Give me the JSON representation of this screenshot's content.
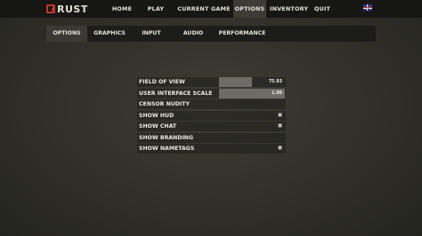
{
  "brand": {
    "name": "RUST",
    "logo_icon": "rust-logo-icon"
  },
  "nav": {
    "items": [
      {
        "label": "HOME",
        "active": false
      },
      {
        "label": "PLAY",
        "active": false
      },
      {
        "label": "CURRENT GAME",
        "active": false
      },
      {
        "label": "OPTIONS",
        "active": true
      },
      {
        "label": "INVENTORY",
        "active": false
      },
      {
        "label": "QUIT",
        "active": false
      }
    ],
    "language_icon": "uk-flag-icon"
  },
  "options_tabs": [
    {
      "label": "OPTIONS",
      "active": true
    },
    {
      "label": "GRAPHICS",
      "active": false
    },
    {
      "label": "INPUT",
      "active": false
    },
    {
      "label": "AUDIO",
      "active": false
    },
    {
      "label": "PERFORMANCE",
      "active": false
    }
  ],
  "settings": {
    "field_of_view": {
      "label": "FIELD OF VIEW",
      "value_text": "75.93",
      "fill_fraction": 0.5
    },
    "ui_scale": {
      "label": "USER INTERFACE SCALE",
      "value_text": "1.00",
      "fill_fraction": 1.0
    },
    "censor_nudity": {
      "label": "CENSOR NUDITY",
      "checked": false
    },
    "show_hud": {
      "label": "SHOW HUD",
      "checked": true,
      "icon": "x-mark-icon",
      "mark": "✖"
    },
    "show_chat": {
      "label": "SHOW CHAT",
      "checked": true,
      "icon": "x-mark-icon",
      "mark": "✖"
    },
    "show_branding": {
      "label": "SHOW BRANDING",
      "checked": false
    },
    "show_nametags": {
      "label": "SHOW NAMETAGS",
      "checked": true,
      "icon": "x-mark-icon",
      "mark": "✖"
    }
  },
  "colors": {
    "brand_red": "#c0392b",
    "active_tab": "#3c3b35",
    "top_bar": "#161614"
  }
}
